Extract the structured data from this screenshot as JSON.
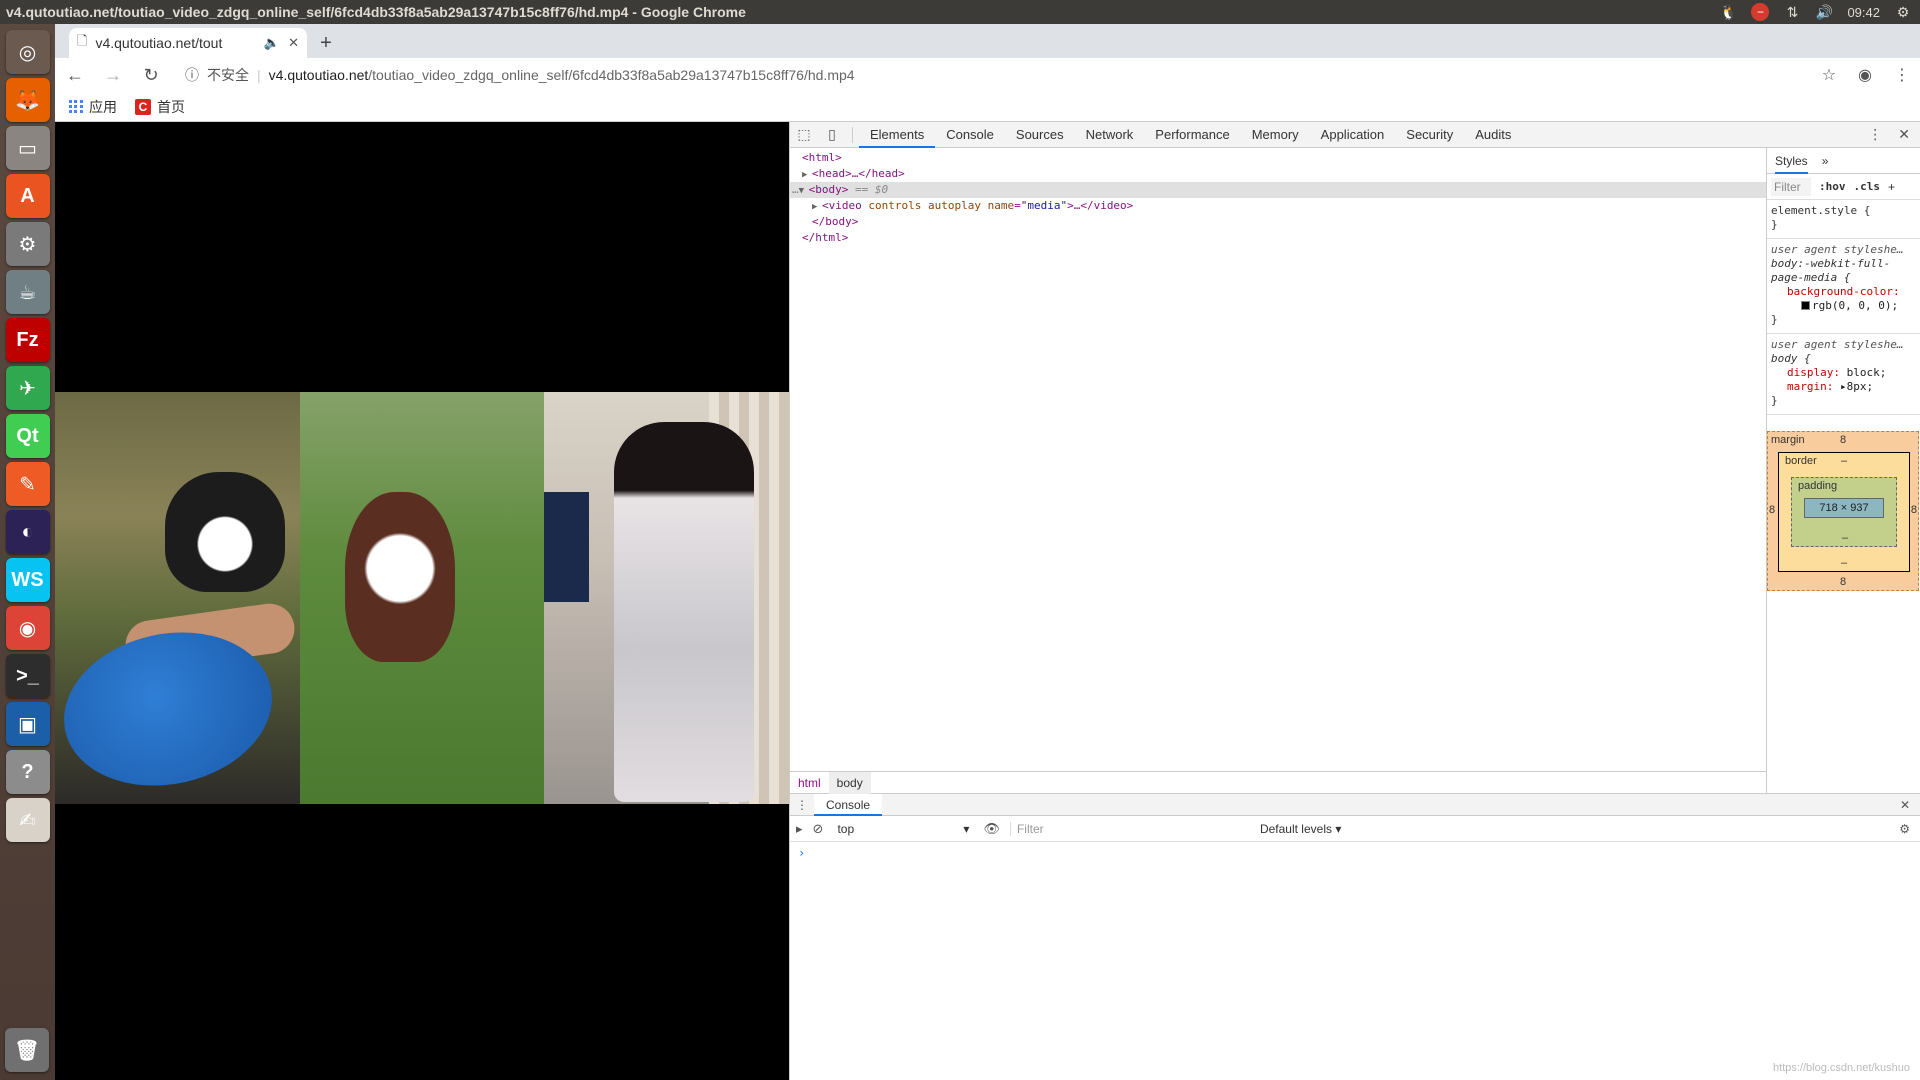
{
  "window_title": "v4.qutoutiao.net/toutiao_video_zdgq_online_self/6fcd4db33f8a5ab29a13747b15c8ff76/hd.mp4 - Google Chrome",
  "tray": {
    "time": "09:42"
  },
  "launcher": {
    "items": [
      {
        "name": "ubuntu-dash-icon",
        "glyph": "◎",
        "color": "#6b5a50"
      },
      {
        "name": "firefox-icon",
        "glyph": "🦊",
        "color": "#e66000"
      },
      {
        "name": "files-icon",
        "glyph": "▭",
        "color": "#8a8580"
      },
      {
        "name": "software-center-icon",
        "glyph": "A",
        "color": "#e95420"
      },
      {
        "name": "system-settings-icon",
        "glyph": "⚙",
        "color": "#7a7a7a"
      },
      {
        "name": "jar-icon",
        "glyph": "☕",
        "color": "#6f7f83"
      },
      {
        "name": "filezilla-icon",
        "glyph": "Fz",
        "color": "#bf0000"
      },
      {
        "name": "telegram-like-icon",
        "glyph": "✈",
        "color": "#2fa84f"
      },
      {
        "name": "qt-creator-icon",
        "glyph": "Qt",
        "color": "#41cd52"
      },
      {
        "name": "postman-icon",
        "glyph": "✎",
        "color": "#ef5b25"
      },
      {
        "name": "eclipse-icon",
        "glyph": "◐",
        "color": "#2c2255"
      },
      {
        "name": "webstorm-icon",
        "glyph": "WS",
        "color": "#07c3f2"
      },
      {
        "name": "chrome-icon",
        "glyph": "◉",
        "color": "#db4437"
      },
      {
        "name": "terminal-icon",
        "glyph": ">_",
        "color": "#2d2d2d"
      },
      {
        "name": "virtualbox-icon",
        "glyph": "▣",
        "color": "#1b5fa8"
      },
      {
        "name": "help-icon",
        "glyph": "?",
        "color": "#8c8c8c"
      },
      {
        "name": "text-editor-icon",
        "glyph": "✍",
        "color": "#d8d2c8"
      }
    ],
    "trash": {
      "name": "trash-icon",
      "glyph": "🗑",
      "color": "#707070"
    }
  },
  "tab": {
    "title": "v4.qutoutiao.net/tout"
  },
  "omnibox": {
    "security_label": "不安全",
    "host": "v4.qutoutiao.net",
    "path": "/toutiao_video_zdgq_online_self/6fcd4db33f8a5ab29a13747b15c8ff76/hd.mp4"
  },
  "bookmarks": {
    "apps": "应用",
    "home": "首页"
  },
  "devtools": {
    "tabs": [
      "Elements",
      "Console",
      "Sources",
      "Network",
      "Performance",
      "Memory",
      "Application",
      "Security",
      "Audits"
    ],
    "active_tab": "Elements",
    "dom": {
      "html_open": "<html>",
      "head": "<head>…</head>",
      "body_open": "<body>",
      "body_marker": " == $0",
      "video_tag": "video",
      "video_attr1": "controls",
      "video_attr2": "autoplay",
      "video_attr3_name": "name",
      "video_attr3_val": "\"media\"",
      "video_rest": ">…</video>",
      "body_close": "</body>",
      "html_close": "</html>"
    },
    "breadcrumbs": [
      "html",
      "body"
    ],
    "styles": {
      "tab": "Styles",
      "filter": "Filter",
      "hov": ":hov",
      "cls": ".cls",
      "element_style": "element.style {",
      "close_brace": "}",
      "ua_source": "user agent styleshe…",
      "rule1_selector": "body:-webkit-full-page-media {",
      "rule1_prop": "background-color:",
      "rule1_val": "rgb(0, 0, 0);",
      "rule2_selector": "body {",
      "rule2_prop1": "display:",
      "rule2_val1": "block;",
      "rule2_prop2": "margin:",
      "rule2_val2": "▸8px;"
    },
    "box_model": {
      "margin_label": "margin",
      "margin_value": "8",
      "border_label": "border",
      "border_value": "–",
      "padding_label": "padding",
      "padding_value": "–",
      "content": "718 × 937"
    },
    "drawer": {
      "tab": "Console",
      "context": "top",
      "filter_placeholder": "Filter",
      "levels": "Default levels ▾",
      "prompt": "›"
    }
  },
  "watermark": "https://blog.csdn.net/kushuo"
}
